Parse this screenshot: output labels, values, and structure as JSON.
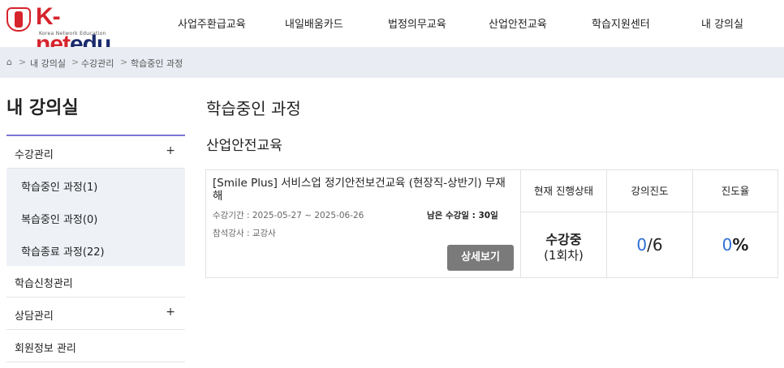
{
  "header": {
    "logo_main": "K-net",
    "logo_edu": "edu",
    "logo_sub": "Korea Network Education",
    "nav": [
      "사업주환급교육",
      "내일배움카드",
      "법정의무교육",
      "산업안전교육",
      "학습지원센터",
      "내 강의실"
    ]
  },
  "breadcrumb": {
    "home_icon": "home-icon",
    "items": [
      "내 강의실",
      "수강관리",
      "학습중인 과정"
    ],
    "separator": ">"
  },
  "sidebar": {
    "title": "내 강의실",
    "accent_color": "#7b74d6",
    "groups": [
      {
        "label": "수강관리",
        "toggle": "+"
      },
      {
        "label": "학습신청관리"
      },
      {
        "label": "상담관리",
        "toggle": "+"
      },
      {
        "label": "회원정보 관리"
      }
    ],
    "sub_items": [
      "학습중인 과정(1)",
      "복습중인 과정(0)",
      "학습종료 과정(22)"
    ]
  },
  "main": {
    "page_title": "학습중인 과정",
    "section_title": "산업안전교육",
    "course": {
      "title": "[Smile Plus] 서비스업 정기안전보건교육 (현장직-상반기) 무재해",
      "period": "수강기간 : 2025-05-27 ~ 2025-06-26",
      "remaining": "남은 수강일 : 30일",
      "teacher": "참석강사 : 교강사",
      "detail_button": "상세보기",
      "headers": {
        "status": "현재 진행상태",
        "progress": "강의진도",
        "rate": "진도율"
      },
      "status_main": "수강중",
      "status_sub": "(1회차)",
      "progress_done": "0",
      "progress_total": "/6",
      "rate_value": "0",
      "rate_unit": "%",
      "accent_color": "#2d6fd6"
    }
  }
}
